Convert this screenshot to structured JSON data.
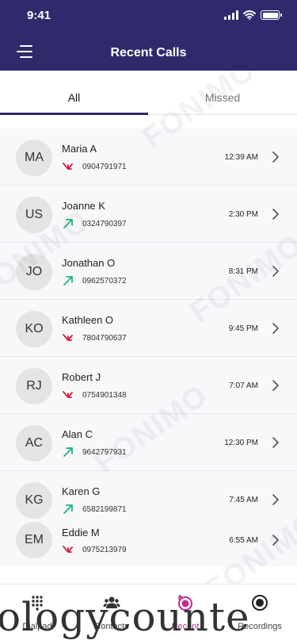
{
  "status_bar": {
    "time": "9:41"
  },
  "header": {
    "title": "Recent Calls"
  },
  "tabs": [
    {
      "label": "All",
      "active": true
    },
    {
      "label": "Missed",
      "active": false
    }
  ],
  "calls": [
    {
      "initials": "MA",
      "name": "Maria A",
      "number": "0904791971",
      "time": "12:39 AM",
      "direction": "incoming"
    },
    {
      "initials": "US",
      "name": "Joanne K",
      "number": "0324790397",
      "time": "2:30 PM",
      "direction": "outgoing"
    },
    {
      "initials": "JO",
      "name": "Jonathan O",
      "number": "0962570372",
      "time": "8:31 PM",
      "direction": "outgoing"
    },
    {
      "initials": "KO",
      "name": "Kathleen O",
      "number": "7804790637",
      "time": "9:45 PM",
      "direction": "incoming"
    },
    {
      "initials": "RJ",
      "name": "Robert J",
      "number": "0754901348",
      "time": "7:07 AM",
      "direction": "incoming"
    },
    {
      "initials": "AC",
      "name": "Alan C",
      "number": "9642797931",
      "time": "12:30 PM",
      "direction": "outgoing"
    },
    {
      "initials": "KG",
      "name": "Karen G",
      "number": "6582199871",
      "time": "7:45 AM",
      "direction": "outgoing"
    },
    {
      "initials": "EM",
      "name": "Eddie M",
      "number": "0975213979",
      "time": "6:55 AM",
      "direction": "incoming"
    }
  ],
  "colors": {
    "header": "#2e2a6b",
    "incoming_arrow": "#d81b43",
    "outgoing_arrow": "#1cb37a",
    "active_nav": "#c02a96"
  },
  "bottom_nav": [
    {
      "label": "Dialpad",
      "icon": "dialpad-icon"
    },
    {
      "label": "Contacts",
      "icon": "contacts-icon"
    },
    {
      "label": "Recent",
      "icon": "recent-icon",
      "active": true
    },
    {
      "label": "Recordings",
      "icon": "record-icon"
    }
  ],
  "watermark": {
    "brand": "FONIMO",
    "tagline": "VoIP Softphone"
  },
  "overlay_text": "ologycounte"
}
